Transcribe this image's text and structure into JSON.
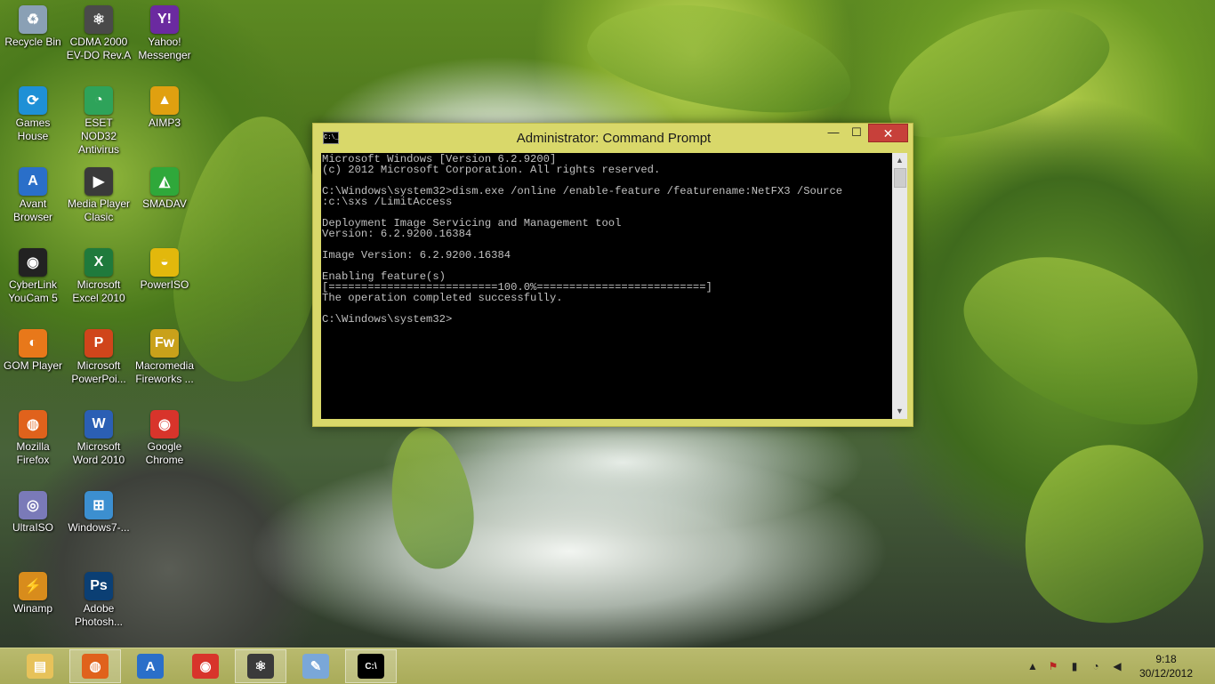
{
  "desktop": {
    "icons": [
      {
        "label": "Recycle Bin",
        "icon": "recycle-bin-icon",
        "glyph": "♻",
        "color": "#8aa0b5"
      },
      {
        "label": "Games House",
        "icon": "games-house-icon",
        "glyph": "⟳",
        "color": "#1e90d6"
      },
      {
        "label": "Avant Browser",
        "icon": "avant-browser-icon",
        "glyph": "A",
        "color": "#2a6fc9"
      },
      {
        "label": "CyberLink YouCam 5",
        "icon": "youcam-icon",
        "glyph": "◉",
        "color": "#222222"
      },
      {
        "label": "GOM Player",
        "icon": "gom-player-icon",
        "glyph": "◐",
        "color": "#e8781a"
      },
      {
        "label": "Mozilla Firefox",
        "icon": "firefox-icon",
        "glyph": "◍",
        "color": "#e0621c"
      },
      {
        "label": "UltraISO",
        "icon": "ultraiso-icon",
        "glyph": "◎",
        "color": "#7a7ab8"
      },
      {
        "label": "Winamp",
        "icon": "winamp-icon",
        "glyph": "⚡",
        "color": "#d88c1c"
      },
      {
        "label": "CDMA 2000 EV-DO Rev.A",
        "icon": "cdma-modem-icon",
        "glyph": "⚛",
        "color": "#4a4a4a"
      },
      {
        "label": "ESET NOD32 Antivirus",
        "icon": "eset-icon",
        "glyph": "◔",
        "color": "#2ea35a"
      },
      {
        "label": "Media Player Clasic",
        "icon": "media-player-classic-icon",
        "glyph": "▶",
        "color": "#3a3a3a"
      },
      {
        "label": "Microsoft Excel 2010",
        "icon": "excel-icon",
        "glyph": "X",
        "color": "#1f7a3c"
      },
      {
        "label": "Microsoft PowerPoi...",
        "icon": "powerpoint-icon",
        "glyph": "P",
        "color": "#d0451b"
      },
      {
        "label": "Microsoft Word 2010",
        "icon": "word-icon",
        "glyph": "W",
        "color": "#2b5fb4"
      },
      {
        "label": "Windows7-...",
        "icon": "windows7-shortcut-icon",
        "glyph": "⊞",
        "color": "#3c8fd0"
      },
      {
        "label": "Adobe Photosh...",
        "icon": "photoshop-icon",
        "glyph": "Ps",
        "color": "#0b3f74"
      },
      {
        "label": "Yahoo! Messenger",
        "icon": "yahoo-messenger-icon",
        "glyph": "Y!",
        "color": "#6b2aa0"
      },
      {
        "label": "AIMP3",
        "icon": "aimp3-icon",
        "glyph": "▲",
        "color": "#e0a010"
      },
      {
        "label": "SMADAV",
        "icon": "smadav-icon",
        "glyph": "◭",
        "color": "#2fa83a"
      },
      {
        "label": "PowerISO",
        "icon": "poweriso-icon",
        "glyph": "◒",
        "color": "#e2b80c"
      },
      {
        "label": "Macromedia Fireworks ...",
        "icon": "fireworks-icon",
        "glyph": "Fw",
        "color": "#c9a11a"
      },
      {
        "label": "Google Chrome",
        "icon": "chrome-icon",
        "glyph": "◉",
        "color": "#d8342b"
      }
    ]
  },
  "cmd_window": {
    "title": "Administrator: Command Prompt",
    "icon_text": "C:\\_",
    "minimize": "—",
    "maximize": "☐",
    "close": "✕",
    "console_lines": [
      "Microsoft Windows [Version 6.2.9200]",
      "(c) 2012 Microsoft Corporation. All rights reserved.",
      "",
      "C:\\Windows\\system32>dism.exe /online /enable-feature /featurename:NetFX3 /Source",
      ":c:\\sxs /LimitAccess",
      "",
      "Deployment Image Servicing and Management tool",
      "Version: 6.2.9200.16384",
      "",
      "Image Version: 6.2.9200.16384",
      "",
      "Enabling feature(s)",
      "[==========================100.0%==========================]",
      "The operation completed successfully.",
      "",
      "C:\\Windows\\system32>"
    ],
    "scroll_up": "▲",
    "scroll_down": "▼"
  },
  "taskbar": {
    "apps": [
      {
        "name": "File Explorer",
        "icon": "file-explorer-icon",
        "glyph": "▤",
        "color": "#e7c25a",
        "active": false
      },
      {
        "name": "Mozilla Firefox",
        "icon": "firefox-icon",
        "glyph": "◍",
        "color": "#e0621c",
        "active": true
      },
      {
        "name": "Avant Browser",
        "icon": "avant-browser-icon",
        "glyph": "A",
        "color": "#2a6fc9",
        "active": false
      },
      {
        "name": "Google Chrome",
        "icon": "chrome-icon",
        "glyph": "◉",
        "color": "#d8342b",
        "active": false
      },
      {
        "name": "CDMA Modem",
        "icon": "cdma-modem-icon",
        "glyph": "⚛",
        "color": "#3a3a3a",
        "active": true
      },
      {
        "name": "Paint",
        "icon": "paint-icon",
        "glyph": "✎",
        "color": "#7aa7d8",
        "active": false
      },
      {
        "name": "Command Prompt",
        "icon": "command-prompt-icon",
        "glyph": "C:\\",
        "color": "#000000",
        "active": true
      }
    ],
    "tray": {
      "show_hidden": "▲",
      "clock_time": "9:18",
      "clock_date": "30/12/2012"
    }
  }
}
